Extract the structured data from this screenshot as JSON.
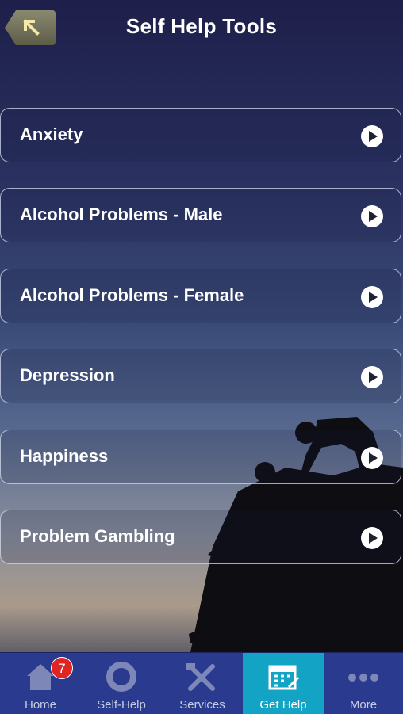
{
  "header": {
    "title": "Self Help Tools"
  },
  "tools": [
    {
      "label": "Anxiety"
    },
    {
      "label": "Alcohol Problems - Male"
    },
    {
      "label": "Alcohol Problems - Female"
    },
    {
      "label": "Depression"
    },
    {
      "label": "Happiness"
    },
    {
      "label": "Problem Gambling"
    }
  ],
  "tabbar": {
    "active": "Get Help",
    "tabs": [
      {
        "label": "Home",
        "icon": "home-icon",
        "badge": "7"
      },
      {
        "label": "Self-Help",
        "icon": "lifebuoy-icon"
      },
      {
        "label": "Services",
        "icon": "tools-icon"
      },
      {
        "label": "Get Help",
        "icon": "calendar-icon"
      },
      {
        "label": "More",
        "icon": "more-dots-icon"
      }
    ]
  },
  "colors": {
    "tabbar": "#2a3a8e",
    "active_tab": "#13a3c5",
    "badge": "#e02424"
  }
}
